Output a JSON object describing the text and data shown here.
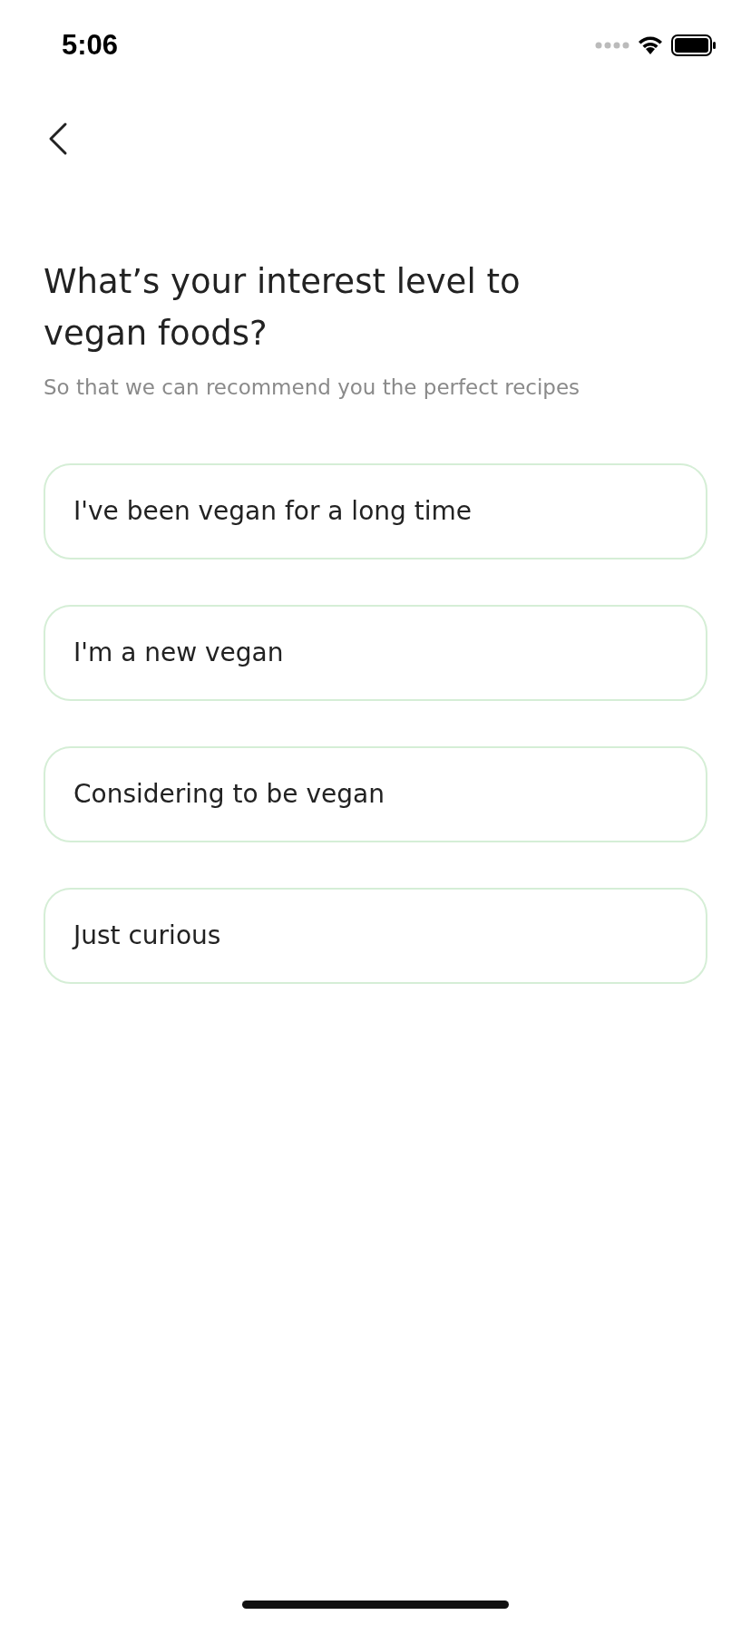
{
  "status_bar": {
    "time": "5:06"
  },
  "title": "What’s your interest level to vegan foods?",
  "subtitle": "So that we can recommend you the perfect recipes",
  "options": [
    {
      "label": "I've been vegan for a long time",
      "selected": false
    },
    {
      "label": "I'm a new vegan",
      "selected": false
    },
    {
      "label": "Considering to be vegan",
      "selected": false
    },
    {
      "label": "Just curious",
      "selected": false
    }
  ]
}
